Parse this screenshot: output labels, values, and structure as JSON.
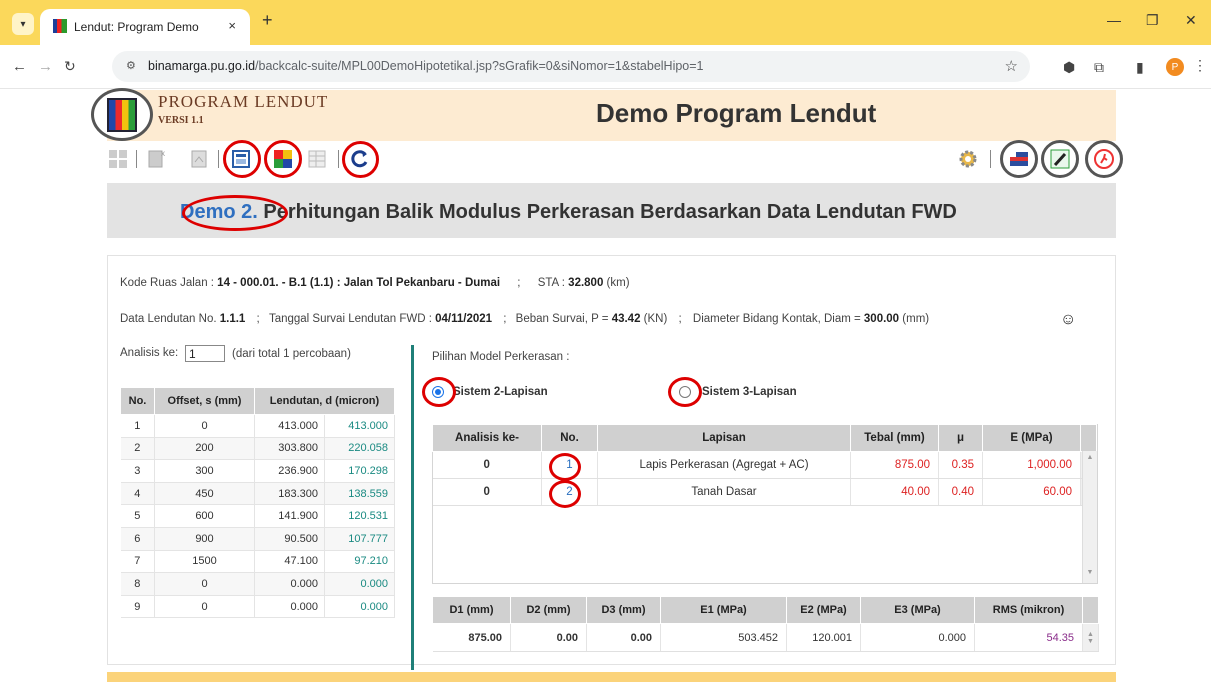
{
  "browser": {
    "tab_title": "Lendut: Program Demo",
    "tab_close": "×",
    "new_tab": "+",
    "url_host": "binamarga.pu.go.id",
    "url_path": "/backcalc-suite/MPL00DemoHipotetikal.jsp?sGrafik=0&siNomor=1&stabelHipo=1",
    "profile_initial": "P"
  },
  "header": {
    "brand_title": "PROGRAM LENDUT",
    "brand_version": "VERSI 1.1",
    "app_title": "Demo Program Lendut"
  },
  "banner": {
    "demo_label": "Demo 2.",
    "title": " Perhitungan Balik Modulus Perkerasan Berdasarkan Data Lendutan FWD"
  },
  "info": {
    "kode_label": "Kode Ruas Jalan : ",
    "kode_value": "14 - 000.01. - B.1 (1.1) : Jalan Tol Pekanbaru - Dumai",
    "sta_label": "STA : ",
    "sta_value": "32.800",
    "sta_unit": " (km)",
    "data_label": "Data Lendutan No. ",
    "data_value": "1.1.1",
    "tanggal_label": "Tanggal Survai Lendutan FWD : ",
    "tanggal_value": "04/11/2021",
    "beban_label": "Beban Survai, P = ",
    "beban_value": "43.42",
    "beban_unit": " (KN)",
    "diam_label": "Diameter Bidang Kontak, Diam = ",
    "diam_value": "300.00",
    "diam_unit": " (mm)",
    "sep": ";"
  },
  "analisis": {
    "label": "Analisis ke:",
    "value": "1",
    "note": "(dari total 1 percobaan)"
  },
  "lendutan_table": {
    "headers": [
      "No.",
      "Offset, s (mm)",
      "Lendutan, d (micron)"
    ],
    "rows": [
      [
        "1",
        "0",
        "413.000",
        "413.000"
      ],
      [
        "2",
        "200",
        "303.800",
        "220.058"
      ],
      [
        "3",
        "300",
        "236.900",
        "170.298"
      ],
      [
        "4",
        "450",
        "183.300",
        "138.559"
      ],
      [
        "5",
        "600",
        "141.900",
        "120.531"
      ],
      [
        "6",
        "900",
        "90.500",
        "107.777"
      ],
      [
        "7",
        "1500",
        "47.100",
        "97.210"
      ],
      [
        "8",
        "0",
        "0.000",
        "0.000"
      ],
      [
        "9",
        "0",
        "0.000",
        "0.000"
      ]
    ]
  },
  "model": {
    "label": "Pilihan Model Perkerasan :",
    "option1": "Sistem 2-Lapisan",
    "option2": "Sistem 3-Lapisan",
    "selected": "Sistem 2-Lapisan"
  },
  "lapisan_table": {
    "headers": [
      "Analisis ke-",
      "No.",
      "Lapisan",
      "Tebal (mm)",
      "μ",
      "E (MPa)"
    ],
    "rows": [
      [
        "0",
        "1",
        "Lapis Perkerasan (Agregat + AC)",
        "875.00",
        "0.35",
        "1,000.00"
      ],
      [
        "0",
        "2",
        "Tanah Dasar",
        "40.00",
        "0.40",
        "60.00"
      ]
    ]
  },
  "result_table": {
    "headers": [
      "D1 (mm)",
      "D2 (mm)",
      "D3 (mm)",
      "E1 (MPa)",
      "E2 (MPa)",
      "E3 (MPa)",
      "RMS (mikron)"
    ],
    "row": [
      "875.00",
      "0.00",
      "0.00",
      "503.452",
      "120.001",
      "0.000",
      "54.35"
    ]
  },
  "colors": {
    "tabbar": "#fbd85b",
    "header_bg": "#fdebd2",
    "teal": "#1f7f78",
    "red_ring": "#d00000",
    "demo_blue": "#2f6fc0"
  }
}
